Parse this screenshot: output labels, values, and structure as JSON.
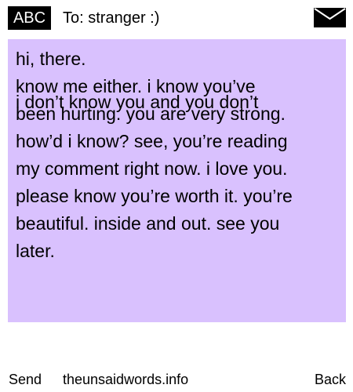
{
  "header": {
    "badge_label": "ABC",
    "recipient": "To: stranger :)",
    "envelope_icon": "envelope-icon"
  },
  "message": {
    "lines_main": "hi, there.\nknow me either. i know you’ve\nbeen hurting. you are very strong.\nhow’d i know? see, you’re reading\nmy comment right now. i love you.\nplease know you’re worth it. you’re\nbeautiful. inside and out. see you\nlater.",
    "overlap_line": "i don’t know you and you don’t",
    "background_color": "#d9c1fe"
  },
  "footer": {
    "send_label": "Send",
    "site_label": "theunsaidwords.info",
    "back_label": "Back"
  }
}
